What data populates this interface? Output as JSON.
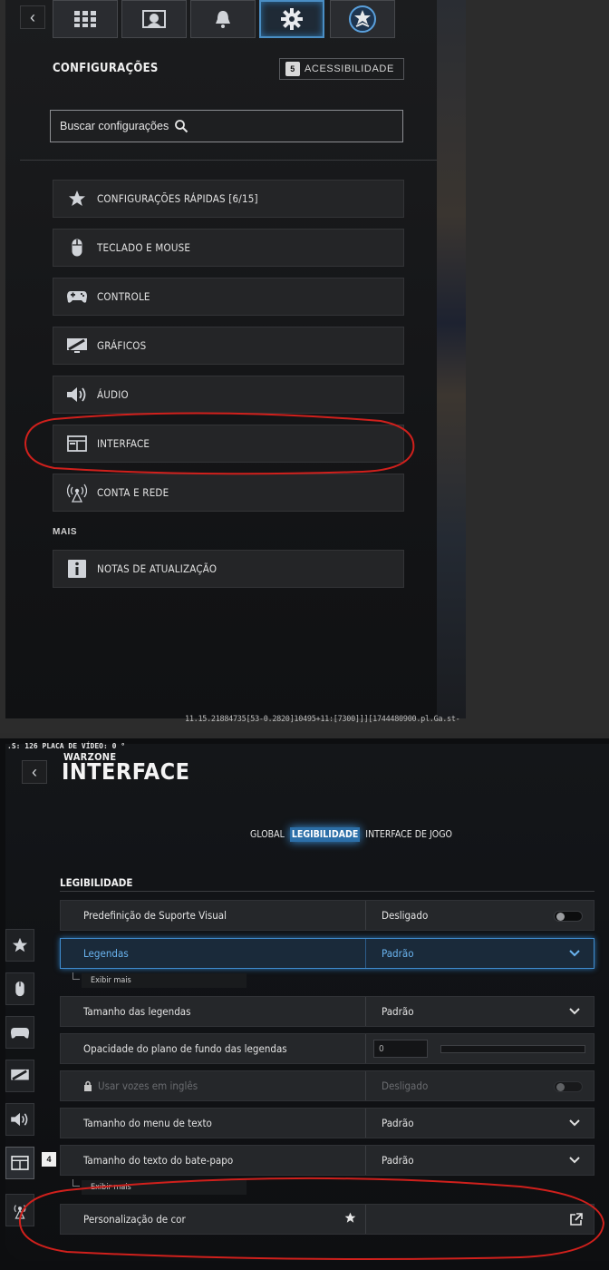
{
  "top": {
    "back_glyph": "‹",
    "tabs": [
      {
        "icon": "grid-icon",
        "active": false
      },
      {
        "icon": "operator-icon",
        "active": false
      },
      {
        "icon": "bell-icon",
        "active": false
      },
      {
        "icon": "gear-icon",
        "active": true
      },
      {
        "icon": "rank-badge-icon",
        "active": false
      }
    ],
    "title": "CONFIGURAÇÕES",
    "accessibility": {
      "key": "5",
      "label": "ACESSIBILIDADE"
    },
    "search_placeholder": "Buscar configurações",
    "menu": [
      {
        "icon": "star-icon",
        "label": "CONFIGURAÇÕES RÁPIDAS [6/15]"
      },
      {
        "icon": "mouse-icon",
        "label": "TECLADO E MOUSE"
      },
      {
        "icon": "gamepad-icon",
        "label": "CONTROLE"
      },
      {
        "icon": "monitor-icon",
        "label": "GRÁFICOS"
      },
      {
        "icon": "speaker-icon",
        "label": "ÁUDIO"
      },
      {
        "icon": "interface-icon",
        "label": "INTERFACE"
      },
      {
        "icon": "network-icon",
        "label": "CONTA E REDE"
      }
    ],
    "more_label": "MAIS",
    "more_menu": [
      {
        "icon": "info-icon",
        "label": "NOTAS DE ATUALIZAÇÃO"
      }
    ],
    "version": "11.15.21884735[53-0.2820]10495+11:[7300]]][1744480900.pl.Ga.st-"
  },
  "bottom": {
    "debug": ".S: 126  PLACA DE VÍDEO: 0 °",
    "back_glyph": "‹",
    "brand": "WARZONE",
    "title": "INTERFACE",
    "tabs": [
      {
        "label": "GLOBAL",
        "active": false
      },
      {
        "label": "LEGIBILIDADE",
        "active": true
      },
      {
        "label": "INTERFACE DE JOGO",
        "active": false
      }
    ],
    "section": "LEGIBILIDADE",
    "sidebar_badge": "4",
    "sidebar": [
      "star-icon",
      "mouse-icon",
      "gamepad-icon",
      "monitor-icon",
      "speaker-icon",
      "interface-icon",
      "network-icon"
    ],
    "rows": [
      {
        "label": "Predefinição de Suporte Visual",
        "value": "Desligado",
        "control": "toggle"
      },
      {
        "label": "Legendas",
        "value": "Padrão",
        "control": "dropdown",
        "selected": true
      },
      {
        "label": "Tamanho das legendas",
        "value": "Padrão",
        "control": "dropdown"
      },
      {
        "label": "Opacidade do plano de fundo das legendas",
        "value": "0",
        "control": "slider"
      },
      {
        "label": "Usar vozes em inglês",
        "value": "Desligado",
        "control": "toggle",
        "disabled": true
      },
      {
        "label": "Tamanho do menu de texto",
        "value": "Padrão",
        "control": "dropdown"
      },
      {
        "label": "Tamanho do texto do bate-papo",
        "value": "Padrão",
        "control": "dropdown"
      },
      {
        "label": "Personalização de cor",
        "value": "",
        "control": "external"
      }
    ],
    "show_more_1": "Exibir mais",
    "show_more_2": "Exibir mais"
  },
  "colors": {
    "accent": "#3f8cd0",
    "annotation": "#d0201c"
  }
}
